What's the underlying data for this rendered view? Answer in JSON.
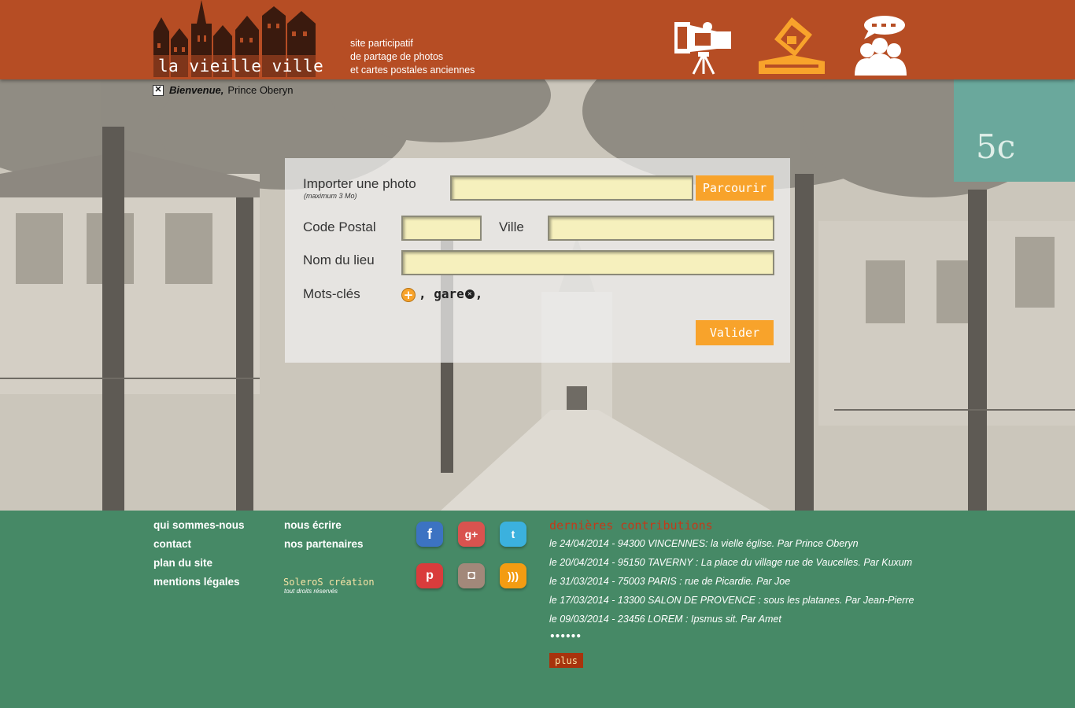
{
  "header": {
    "logo_text": "la vieille ville",
    "tagline": [
      "site participatif",
      "de partage de photos",
      "et cartes postales anciennes"
    ],
    "icons": [
      "camera-icon",
      "photos-upload-icon",
      "community-icon"
    ]
  },
  "welcome": {
    "greeting": "Bienvenue,",
    "user": "Prince Oberyn"
  },
  "form": {
    "import_label": "Importer une photo",
    "import_sub": "(maximum 3 Mo)",
    "browse_button": "Parcourir",
    "postal_label": "Code Postal",
    "city_label": "Ville",
    "place_label": "Nom du lieu",
    "keywords_label": "Mots-clés",
    "keywords": [
      "gare"
    ],
    "submit_button": "Valider"
  },
  "footer": {
    "links_col1": [
      "qui sommes-nous",
      "contact",
      "plan du site",
      "mentions légales"
    ],
    "links_col2": [
      "nous écrire",
      "nos partenaires"
    ],
    "credit": "SoleroS création",
    "credit_sub": "tout droits réservés",
    "contributions_title": "dernières contributions",
    "contributions": [
      "le 24/04/2014 - 94300 VINCENNES: la vielle église.  Par Prince Oberyn",
      "le 20/04/2014 - 95150 TAVERNY : La place du village rue de Vaucelles.  Par Kuxum",
      "le 31/03/2014 - 75003 PARIS : rue de Picardie.  Par Joe",
      "le 17/03/2014 - 13300 SALON DE PROVENCE : sous les platanes.  Par Jean-Pierre",
      "le 09/03/2014 - 23456 LOREM : Ipsmus sit. Par Amet"
    ],
    "dots": "••••••",
    "more_button": "plus"
  },
  "colors": {
    "header_bg": "#b64d24",
    "footer_bg": "#468966",
    "accent_orange": "#f8a32b",
    "input_bg": "#f6f0bd",
    "contrib_title": "#c23a1a"
  }
}
